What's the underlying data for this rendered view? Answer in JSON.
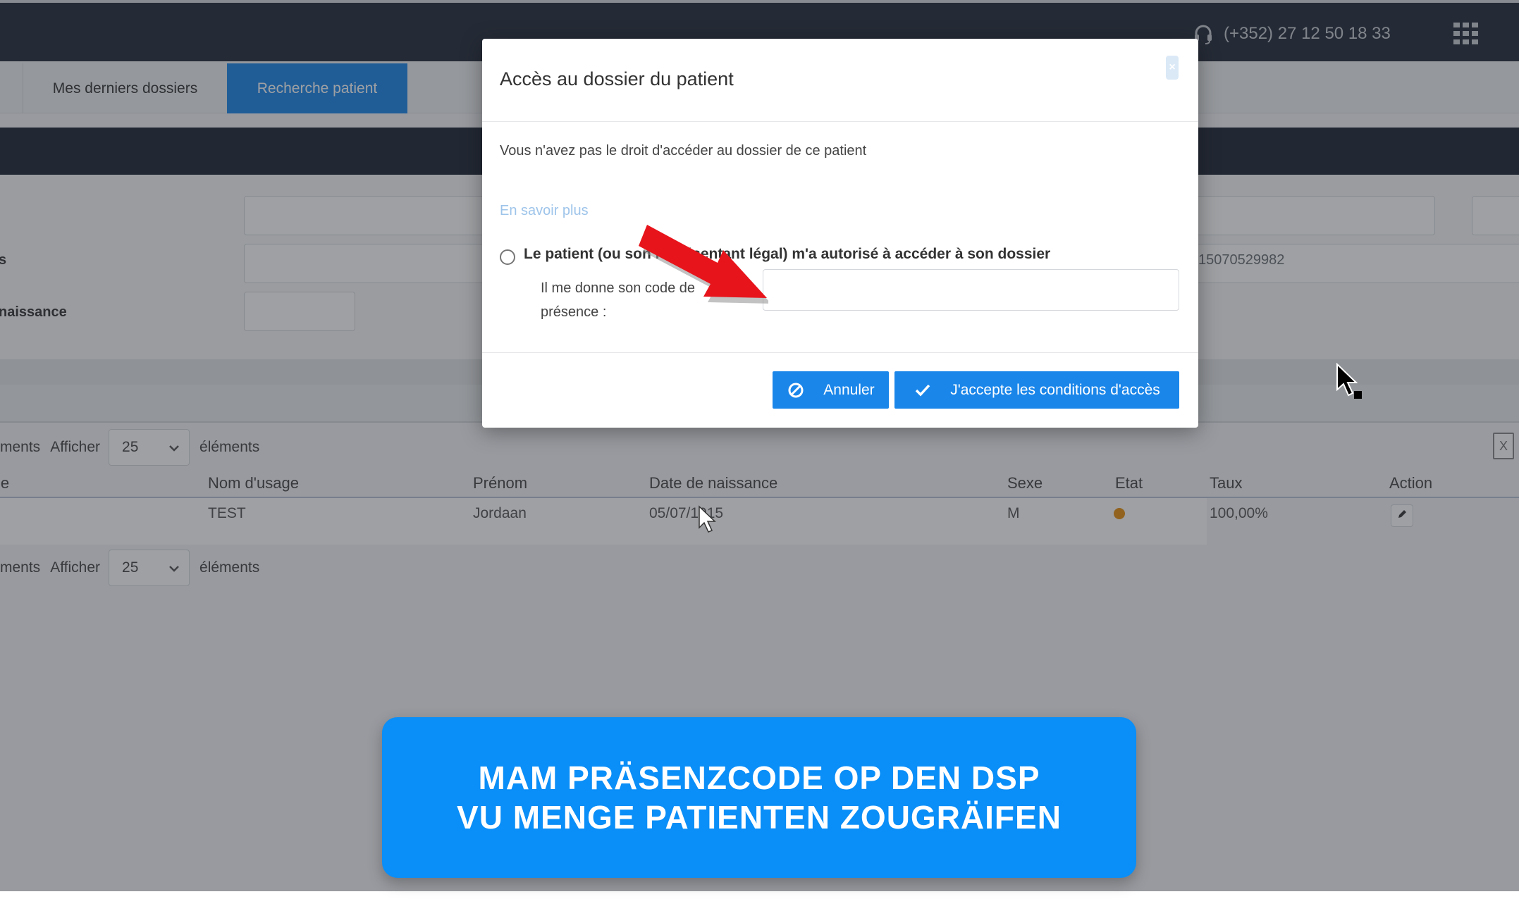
{
  "header": {
    "phone": "(+352) 27 12 50 18 33",
    "icons": {
      "phone": "headset-icon",
      "apps": "grid-apps-icon"
    }
  },
  "tabs": [
    {
      "label": "Mes derniers dossiers",
      "active": false
    },
    {
      "label": "Recherche patient",
      "active": true
    }
  ],
  "search_form": {
    "label_partial_1": "s",
    "label_partial_2": "naissance",
    "ssn_value_partial": "15070529982"
  },
  "list": {
    "prefix": "ments",
    "show_label": "Afficher",
    "page_size": "25",
    "suffix": "éléments"
  },
  "table": {
    "columns": [
      "le",
      "Nom d'usage",
      "Prénom",
      "Date de naissance",
      "Sexe",
      "Etat",
      "Taux",
      "Action"
    ],
    "rows": [
      {
        "nom": "TEST",
        "prenom": "Jordaan",
        "naissance": "05/07/1915",
        "sexe": "M",
        "taux": "100,00%"
      }
    ]
  },
  "modal": {
    "title": "Accès au dossier du patient",
    "close_symbol": "×",
    "message": "Vous n'avez pas le droit d'accéder au dossier de ce patient",
    "learn_more": "En savoir plus",
    "radio_label": "Le patient (ou son représentant légal) m'a autorisé à accéder à son dossier",
    "code_label": "Il me donne son code de présence :",
    "code_value": "",
    "cancel_label": "Annuler",
    "accept_label": "J'accepte les conditions d'accès"
  },
  "caption": {
    "line1": "MAM PRÄSENZCODE OP DEN DSP",
    "line2": "VU MENGE PATIENTEN ZOUGRÄIFEN"
  },
  "colors": {
    "primary": "#1a86ea",
    "caption_bg": "#0a8ef7",
    "topbar": "#232b3a",
    "arrow": "#e8141b",
    "state_dot": "#e9900f"
  }
}
